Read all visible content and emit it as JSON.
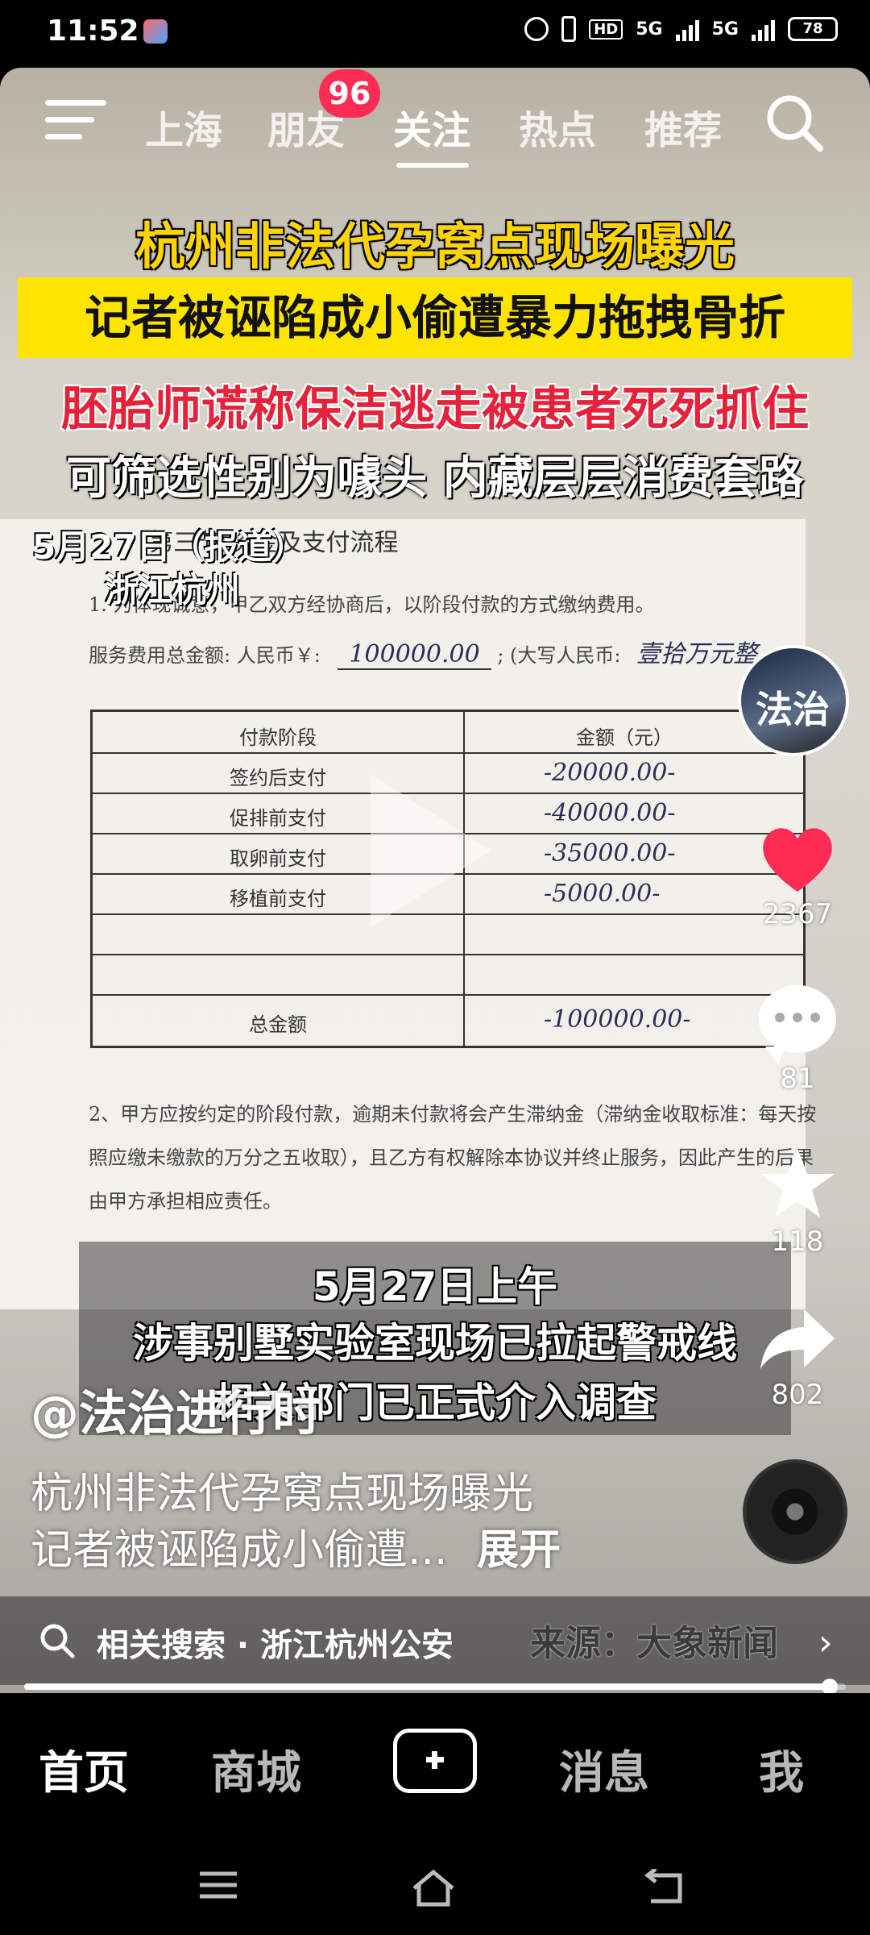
{
  "status_bar": {
    "time": "11:52",
    "hd_label": "HD",
    "net1": "5G",
    "net2": "5G",
    "battery": "78"
  },
  "top_nav": {
    "tabs": [
      {
        "label": "上海"
      },
      {
        "label": "朋友"
      },
      {
        "label": "关注"
      },
      {
        "label": "热点"
      },
      {
        "label": "推荐"
      }
    ],
    "friends_badge": "96",
    "active_tab": "关注"
  },
  "video": {
    "headlines": [
      "杭州非法代孕窝点现场曝光",
      "记者被诬陷成小偷遭暴力拖拽骨折",
      "胚胎师谎称保洁逃走被患者死死抓住",
      "可筛选性别为噱头 内藏层层消费套路"
    ],
    "date_label": "5月27日（报道）",
    "location_label": "浙江杭州",
    "document": {
      "section_title": "第三节 资金及支付流程",
      "line1": "1. 为体现诚意，甲乙双方经协商后，以阶段付款的方式缴纳费用。",
      "fee_label": "服务费用总金额: 人民币￥:",
      "fee_value": "100000.00",
      "fee_caps_label": "; (大写人民币:",
      "fee_caps_value": "壹拾万元整",
      "table_header_stage": "付款阶段",
      "table_header_amount": "金额（元）",
      "rows": [
        {
          "stage": "签约后支付",
          "amount": "-20000.00-"
        },
        {
          "stage": "促排前支付",
          "amount": "-40000.00-"
        },
        {
          "stage": "取卵前支付",
          "amount": "-35000.00-"
        },
        {
          "stage": "移植前支付",
          "amount": "-5000.00-"
        }
      ],
      "total_label": "总金额",
      "total_value": "-100000.00-",
      "clause2_l1": "2、甲方应按约定的阶段付款，逾期未付款将会产生滞纳金（滞纳金收取标准：每天按",
      "clause2_l2": "照应缴未缴款的万分之五收取），且乙方有权解除本协议并终止服务，因此产生的后果",
      "clause2_l3": "由甲方承担相应责任。"
    },
    "captions": [
      "5月27日上午",
      "涉事别墅实验室现场已拉起警戒线",
      "相关部门已正式介入调查"
    ],
    "author": "@法治进行时",
    "description_line1": "杭州非法代孕窝点现场曝光",
    "description_line2": "记者被诬陷成小偷遭...",
    "expand_label": "展开"
  },
  "side_actions": {
    "avatar_text": "法治",
    "likes": "2367",
    "comments": "81",
    "favorites": "118",
    "shares": "802"
  },
  "related": {
    "search_text": "相关搜索 · 浙江杭州公安",
    "source_text": "来源：大象新闻"
  },
  "progress": {
    "value": 0.98
  },
  "bottom_nav": {
    "items": [
      "首页",
      "商城",
      "消息",
      "我"
    ],
    "active": "首页"
  },
  "colors": {
    "accent_red": "#fe2c55",
    "headline_yellow": "#ffd400",
    "banner_yellow": "#ffe400",
    "headline_red": "#e8213a"
  }
}
